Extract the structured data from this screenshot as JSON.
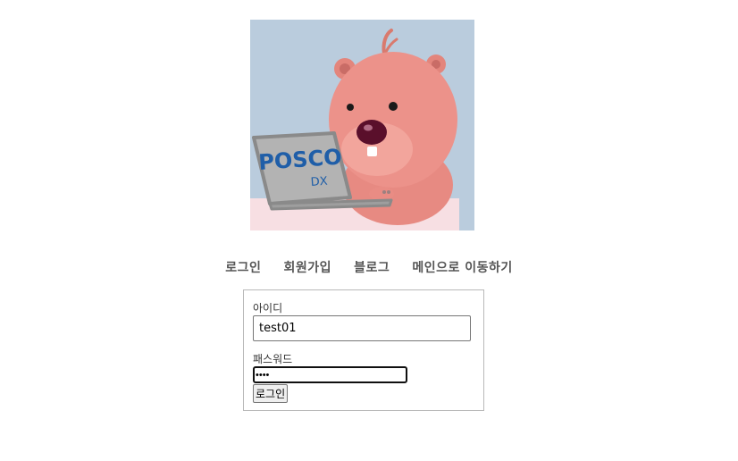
{
  "hero": {
    "logo_text": "POSCO",
    "logo_subtext": "DX"
  },
  "nav": {
    "items": [
      {
        "label": "로그인"
      },
      {
        "label": "회원가입"
      },
      {
        "label": "블로그"
      },
      {
        "label": "메인으로 이동하기"
      }
    ]
  },
  "login_form": {
    "id_label": "아이디",
    "id_value": "test01",
    "password_label": "패스워드",
    "password_value": "••••",
    "submit_label": "로그인"
  },
  "colors": {
    "hero_background": "#BACCDD",
    "character_pink": "#E98C84",
    "desk": "#F7DFE3",
    "laptop": "#A6A6A6",
    "logo_blue": "#1F5EA8"
  }
}
